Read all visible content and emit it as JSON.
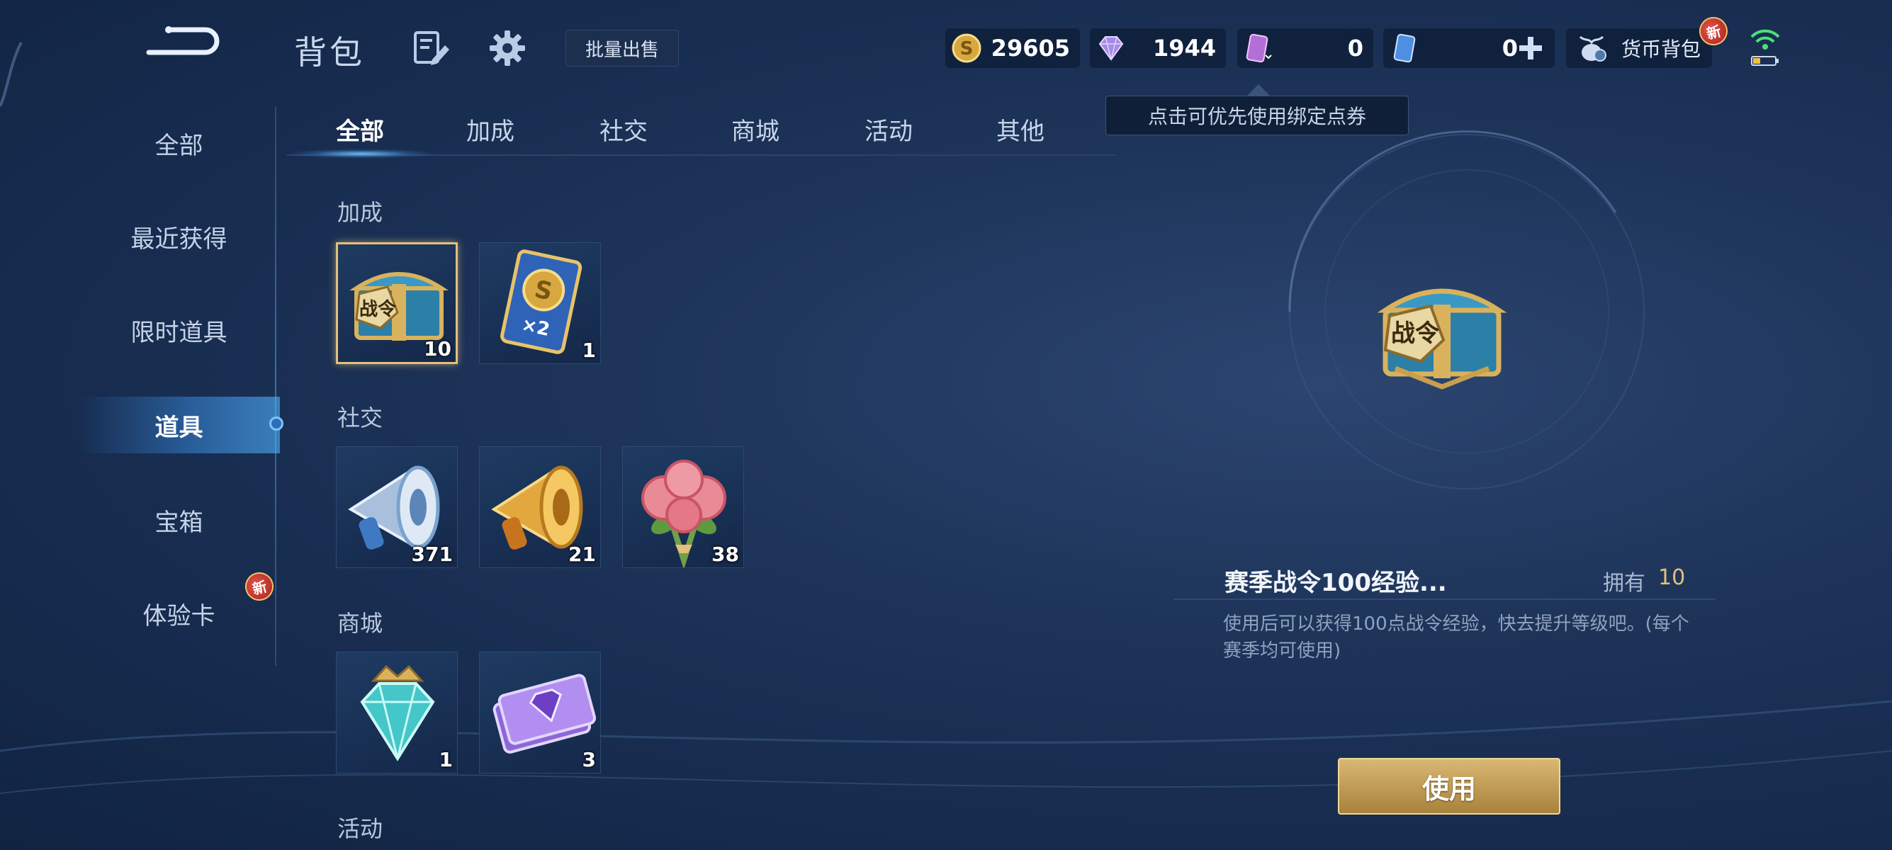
{
  "header": {
    "title": "背包",
    "bulk_sell": "批量出售"
  },
  "currencies": {
    "gold": "29605",
    "diamond": "1944",
    "voucher_bound": "0",
    "voucher": "0",
    "wallet_label": "货币背包",
    "wallet_badge": "新"
  },
  "tooltip": "点击可优先使用绑定点券",
  "sidebar": {
    "items": [
      {
        "label": "全部"
      },
      {
        "label": "最近获得"
      },
      {
        "label": "限时道具"
      },
      {
        "label": "道具"
      },
      {
        "label": "宝箱"
      },
      {
        "label": "体验卡"
      }
    ],
    "badge": "新"
  },
  "tabs": [
    {
      "label": "全部"
    },
    {
      "label": "加成"
    },
    {
      "label": "社交"
    },
    {
      "label": "商城"
    },
    {
      "label": "活动"
    },
    {
      "label": "其他"
    }
  ],
  "sections": [
    {
      "label": "加成",
      "items": [
        {
          "icon": "battle-pass-chest-icon",
          "qty": "10",
          "emblem": "战令"
        },
        {
          "icon": "gold-double-card-icon",
          "qty": "1",
          "mark": "×2"
        }
      ]
    },
    {
      "label": "社交",
      "items": [
        {
          "icon": "silver-megaphone-icon",
          "qty": "371"
        },
        {
          "icon": "gold-megaphone-icon",
          "qty": "21"
        },
        {
          "icon": "rose-bouquet-icon",
          "qty": "38"
        }
      ]
    },
    {
      "label": "商城",
      "items": [
        {
          "icon": "crystal-gem-icon",
          "qty": "1"
        },
        {
          "icon": "diamond-ticket-icon",
          "qty": "3"
        }
      ]
    },
    {
      "label": "活动",
      "items": []
    }
  ],
  "detail": {
    "emblem": "战令",
    "name": "赛季战令100经验...",
    "own_label": "拥有",
    "own_value": "10",
    "description": "使用后可以获得100点战令经验，快去提升等级吧。(每个赛季均可使用)",
    "use_button": "使用"
  }
}
